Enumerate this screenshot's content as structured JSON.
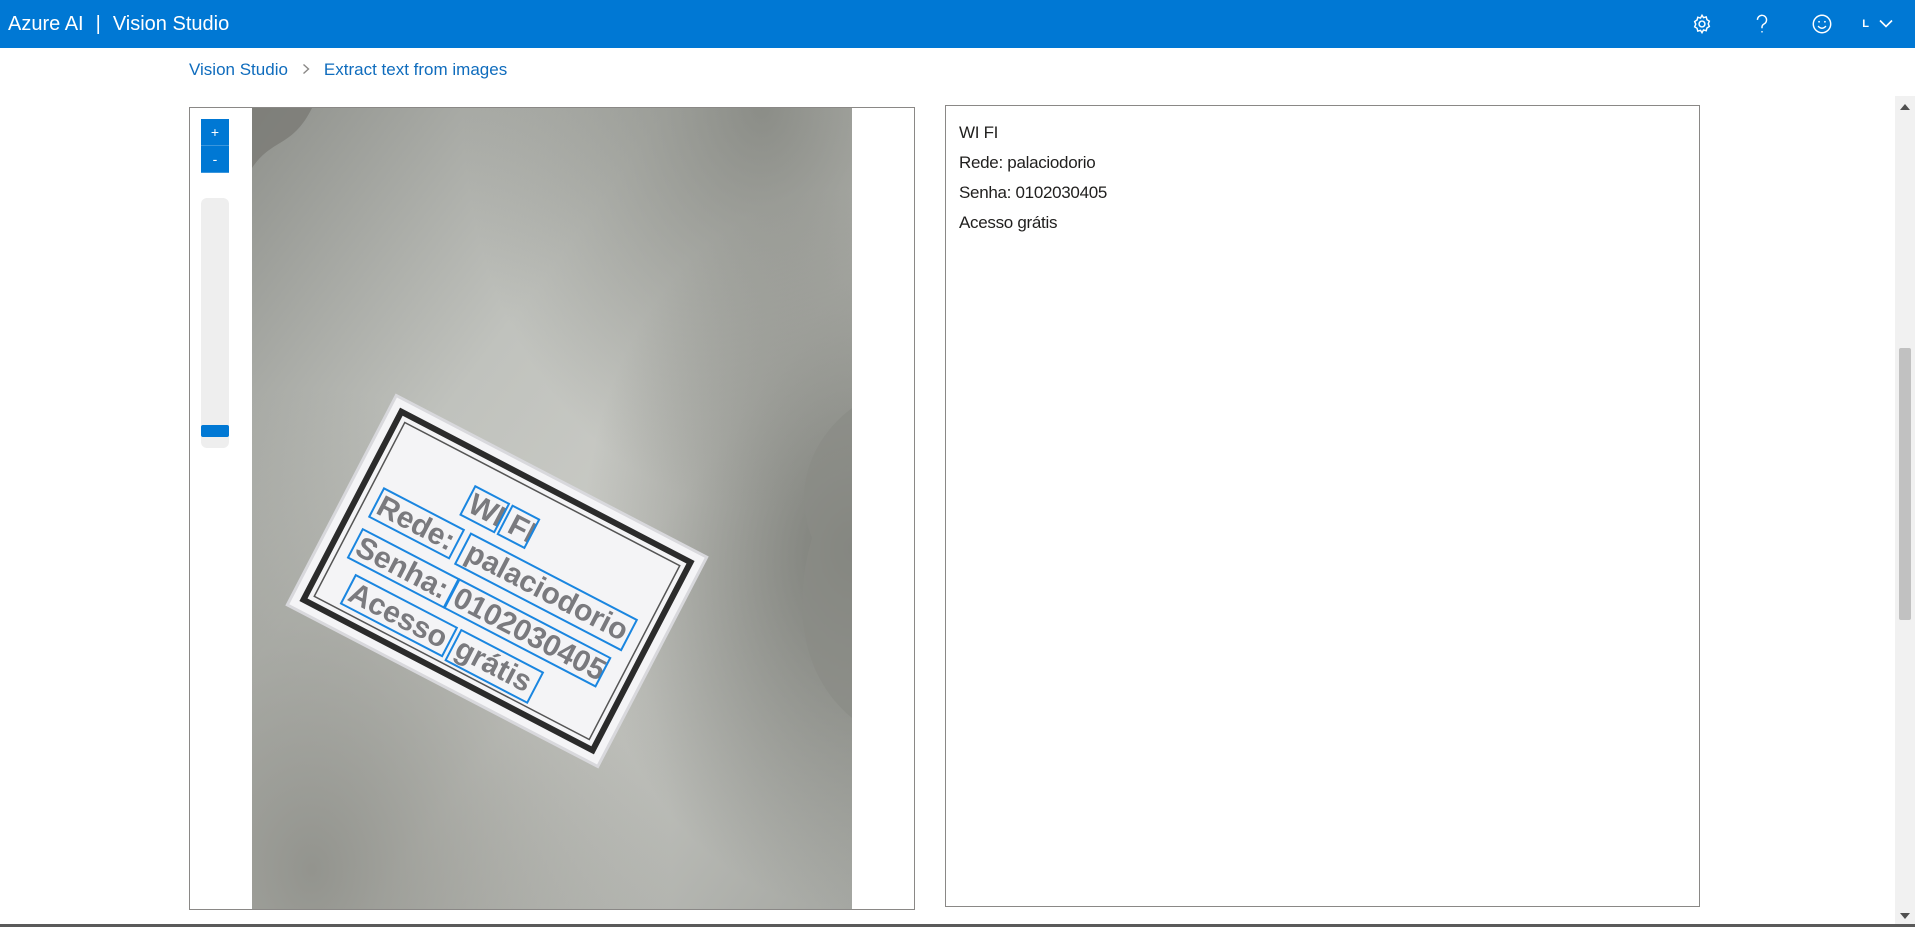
{
  "header": {
    "brand": "Azure AI",
    "separator": "|",
    "product": "Vision Studio",
    "user_initial": "L",
    "icons": [
      "settings-icon",
      "help-icon",
      "feedback-smiley-icon",
      "chevron-down-icon"
    ]
  },
  "breadcrumb": {
    "items": [
      "Vision Studio",
      "Extract text from images"
    ],
    "separator": ">"
  },
  "image_viewer": {
    "zoom_in_label": "+",
    "zoom_out_label": "-",
    "zoom_level_fraction": 0.05,
    "detected_words": [
      "WI",
      "FI",
      "Rede:",
      "palaciodorio",
      "Senha:",
      "0102030405",
      "Acesso",
      "grátis"
    ]
  },
  "result": {
    "lines": [
      "WI FI",
      "Rede: palaciodorio",
      "Senha: 0102030405",
      "Acesso grátis"
    ]
  },
  "colors": {
    "accent": "#0078d4",
    "bounding_box": "#1a86e0"
  }
}
